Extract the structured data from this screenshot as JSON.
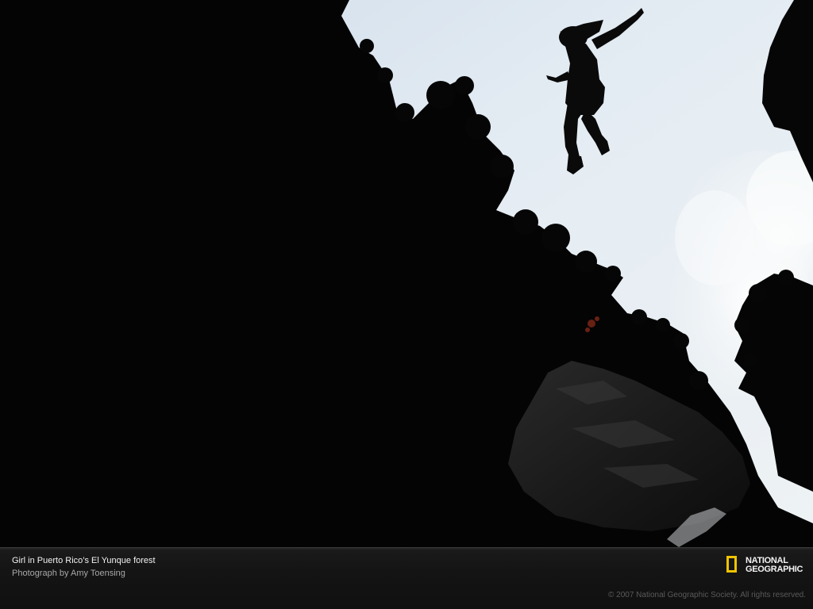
{
  "photo": {
    "subject": "cliff jumper silhouette"
  },
  "caption": {
    "title": "Girl in Puerto Rico’s El Yunque forest",
    "credit": "Photograph by Amy Toensing"
  },
  "logo": {
    "line1": "NATIONAL",
    "line2": "GEOGRAPHIC",
    "border_color": "#F2C300"
  },
  "copyright": "© 2007 National Geographic Society. All rights reserved.",
  "colors": {
    "sky": "#E6EEF5",
    "foliage": "#050505",
    "caption_bar": "#151515"
  }
}
